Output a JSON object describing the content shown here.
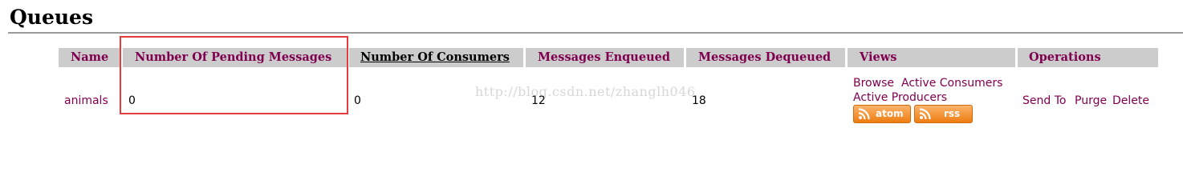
{
  "page": {
    "title": "Queues"
  },
  "table": {
    "headers": [
      {
        "key": "name",
        "label": "Name"
      },
      {
        "key": "pending",
        "label": "Number Of Pending Messages"
      },
      {
        "key": "consumers",
        "label": "Number Of Consumers",
        "sorted": true
      },
      {
        "key": "enqueued",
        "label": "Messages Enqueued"
      },
      {
        "key": "dequeued",
        "label": "Messages Dequeued"
      },
      {
        "key": "views",
        "label": "Views"
      },
      {
        "key": "operations",
        "label": "Operations"
      }
    ],
    "rows": [
      {
        "name": "animals",
        "pending": "0",
        "consumers": "0",
        "enqueued": "12",
        "dequeued": "18",
        "views": {
          "browse": "Browse",
          "active_consumers": "Active Consumers",
          "active_producers": "Active Producers",
          "atom": "atom",
          "rss": "rss"
        },
        "operations": {
          "send_to": "Send To",
          "purge": "Purge",
          "delete": "Delete"
        }
      }
    ]
  },
  "watermark": "http://blog.csdn.net/zhanglh046",
  "colors": {
    "header_bg": "#cccccc",
    "header_text": "#800050",
    "link": "#800050",
    "highlight": "#e23c3c",
    "feed_orange": "#ee7d12"
  }
}
